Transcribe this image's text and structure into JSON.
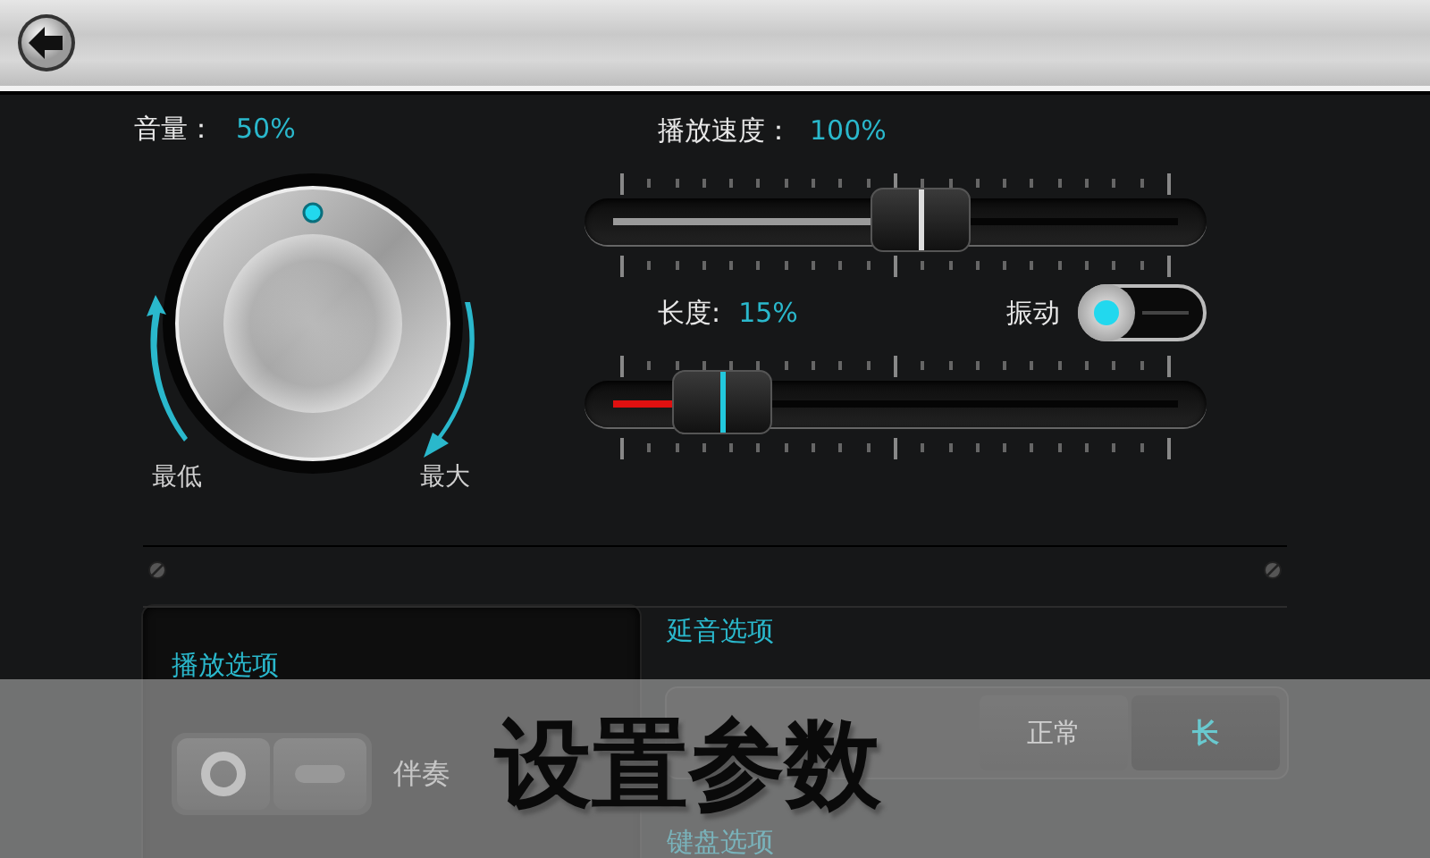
{
  "top_bar": {
    "back_button": true
  },
  "volume": {
    "label": "音量：",
    "value": "50%",
    "level": 0.5,
    "min_label": "最低",
    "max_label": "最大"
  },
  "sliders": [
    {
      "kind": "speed",
      "label": "播放速度：",
      "value": "100%",
      "level": 0.5,
      "color": "#9a9a9a"
    },
    {
      "kind": "length",
      "label": "长度:",
      "value": "15%",
      "level": 0.15,
      "color": "#e01010"
    }
  ],
  "vibration": {
    "label": "振动",
    "on": false
  },
  "playback_options": {
    "title": "播放选项",
    "accompaniment_label": "伴奏",
    "accompaniment_on": true
  },
  "sustain_options": {
    "title": "延音选项",
    "segments": [
      {
        "label": "正常",
        "selected": false
      },
      {
        "label": "长",
        "selected": true
      }
    ]
  },
  "keyboard_options": {
    "title": "键盘选项"
  },
  "caption_banner": {
    "text": "设置参数"
  }
}
